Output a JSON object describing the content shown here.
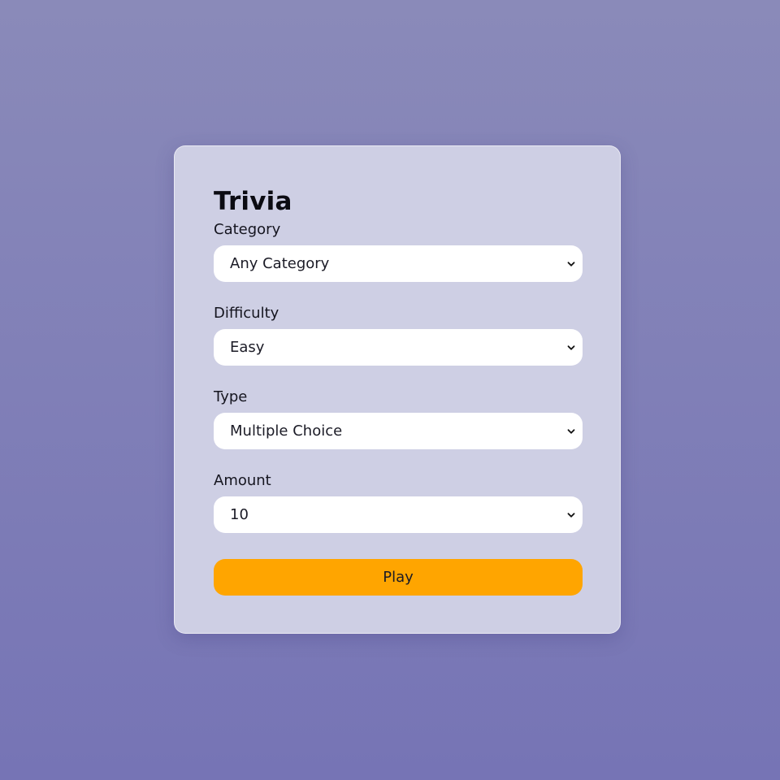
{
  "app": {
    "title": "Trivia"
  },
  "form": {
    "category": {
      "label": "Category",
      "selected": "Any Category"
    },
    "difficulty": {
      "label": "Difficulty",
      "selected": "Easy"
    },
    "type": {
      "label": "Type",
      "selected": "Multiple Choice"
    },
    "amount": {
      "label": "Amount",
      "selected": "10"
    },
    "play_label": "Play"
  },
  "colors": {
    "accent": "#ffa500",
    "card": "#cecfe4",
    "background_top": "#8a8ab9",
    "background_bottom": "#7674b5"
  },
  "icons": {
    "select_arrow": "chevron-down-icon"
  }
}
